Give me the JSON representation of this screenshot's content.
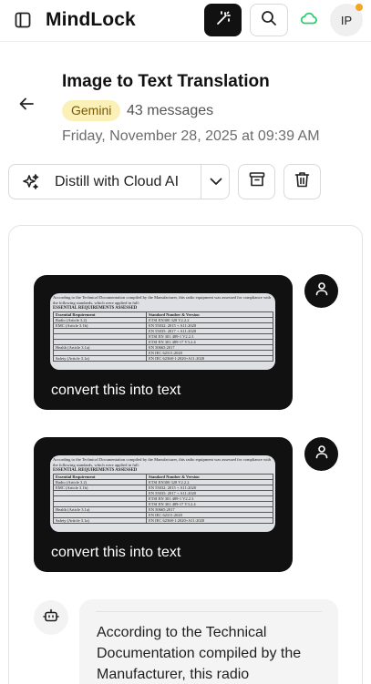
{
  "app": {
    "title": "MindLock",
    "avatar_initials": "IP",
    "accent_color": "#111111",
    "cloud_color": "#2ecc71"
  },
  "icons": {
    "sidebar": "sidebar-toggle-icon",
    "magic": "magic-wand-icon",
    "search": "search-icon",
    "cloud": "cloud-icon",
    "back": "arrow-left-icon",
    "distill": "sparkles-icon",
    "caret": "chevron-down-icon",
    "archive": "archive-icon",
    "delete": "trash-icon",
    "user": "user-icon",
    "bot": "bot-icon"
  },
  "conversation": {
    "title": "Image to Text Translation",
    "model": "Gemini",
    "message_count": "43 messages",
    "date": "Friday, November 28, 2025 at 09:39 AM"
  },
  "actions": {
    "distill_label": "Distill with Cloud AI"
  },
  "document_image": {
    "intro": "According to the Technical Documentation compiled by the Manufacturer, this radio equipment was assessed for compliance with the following standards, which were applied in full:",
    "heading": "ESSENTIAL REQUIREMENTS ASSESSED",
    "col_requirement": "Essential Requirement",
    "col_standard": "Standard Number & Version",
    "rows": [
      {
        "req": "Radio (Article 3.2)",
        "std": "ETSI EN300 328 V2.2.2"
      },
      {
        "req": "EMC (Article 3.1b)",
        "std": "EN 55032: 2015 + A11:2020"
      },
      {
        "req": "",
        "std": "EN 55035: 2017 + A11:2020"
      },
      {
        "req": "",
        "std": "ETSI EN 301 489-1 V2.2.3"
      },
      {
        "req": "",
        "std": "ETSI EN 301 489-17 V3.2.4"
      },
      {
        "req": "Health (Article 3.1a)",
        "std": "EN 50665:2017"
      },
      {
        "req": "",
        "std": "EN IEC 62311:2020"
      },
      {
        "req": "Safety (Article 3.1a)",
        "std": "EN IEC 62368-1:2020+A11:2020"
      }
    ]
  },
  "messages": [
    {
      "role": "user",
      "text": "convert this into text"
    },
    {
      "role": "user",
      "text": "convert this into text"
    },
    {
      "role": "assistant",
      "text": "According to the Technical Documentation compiled by the Manufacturer, this radio"
    }
  ]
}
